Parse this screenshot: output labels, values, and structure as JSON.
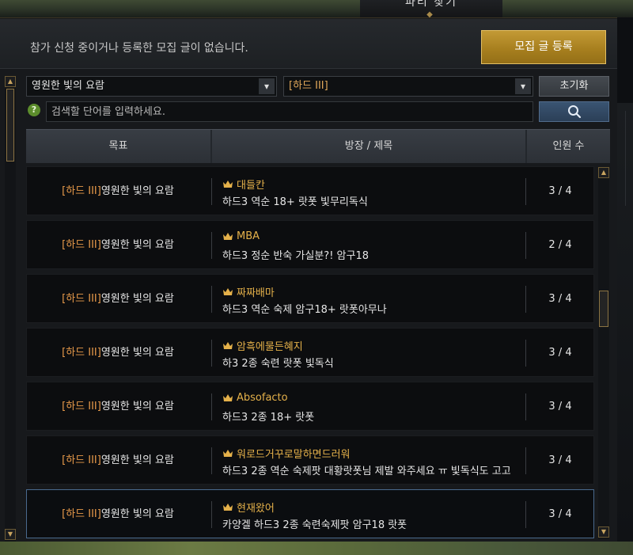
{
  "window": {
    "title": "파티 찾기"
  },
  "notice": {
    "text": "참가 신청 중이거나 등록한 모집 글이 없습니다."
  },
  "recruit_button": {
    "label": "모집 글 등록"
  },
  "filters": {
    "raid": {
      "selected": "영원한 빛의 요람"
    },
    "difficulty": {
      "selected": "[하드 III]"
    },
    "reset_label": "초기화",
    "search_placeholder": "검색할 단어를 입력하세요.",
    "help_glyph": "?"
  },
  "table": {
    "headers": {
      "target": "목표",
      "leader_title": "방장 / 제목",
      "members": "인원 수"
    },
    "rows": [
      {
        "difficulty": "[하드 III]",
        "raid": "영원한 빛의 요람",
        "leader": "대들칸",
        "title": "하드3 역순 18+ 랏폿 빛무리독식",
        "count": "3 / 4"
      },
      {
        "difficulty": "[하드 III]",
        "raid": "영원한 빛의 요람",
        "leader": "MBA",
        "title": "하드3 정순 반숙 가실분?! 암구18",
        "count": "2 / 4"
      },
      {
        "difficulty": "[하드 III]",
        "raid": "영원한 빛의 요람",
        "leader": "짜짜배마",
        "title": "하드3 역순 숙제 암구18+ 랏폿아무나",
        "count": "3 / 4"
      },
      {
        "difficulty": "[하드 III]",
        "raid": "영원한 빛의 요람",
        "leader": "암흑에물든혜지",
        "title": "하3 2종 숙련 랏폿 빛독식",
        "count": "3 / 4"
      },
      {
        "difficulty": "[하드 III]",
        "raid": "영원한 빛의 요람",
        "leader": "Absofacto",
        "title": "하드3 2종 18+ 랏폿",
        "count": "3 / 4"
      },
      {
        "difficulty": "[하드 III]",
        "raid": "영원한 빛의 요람",
        "leader": "워로드거꾸로말하면드러워",
        "title": "하드3 2종 역순 숙제팟 대황랏폿님 제발 와주세요 ㅠ 빛독식도 고고",
        "count": "3 / 4"
      },
      {
        "difficulty": "[하드 III]",
        "raid": "영원한 빛의 요람",
        "leader": "현재왔어",
        "title": "카양겔 하드3 2종 숙련숙제팟 암구18 랏폿",
        "count": "3 / 4"
      }
    ]
  },
  "colors": {
    "accent_gold": "#c39a36",
    "difficulty_orange": "#e89a4a",
    "leader_gold": "#e5b14a",
    "selected_border": "#4a6a8e"
  },
  "icons": {
    "caret": "chevron-down-icon",
    "search": "search-icon",
    "crown": "crown-icon",
    "help": "help-icon"
  }
}
